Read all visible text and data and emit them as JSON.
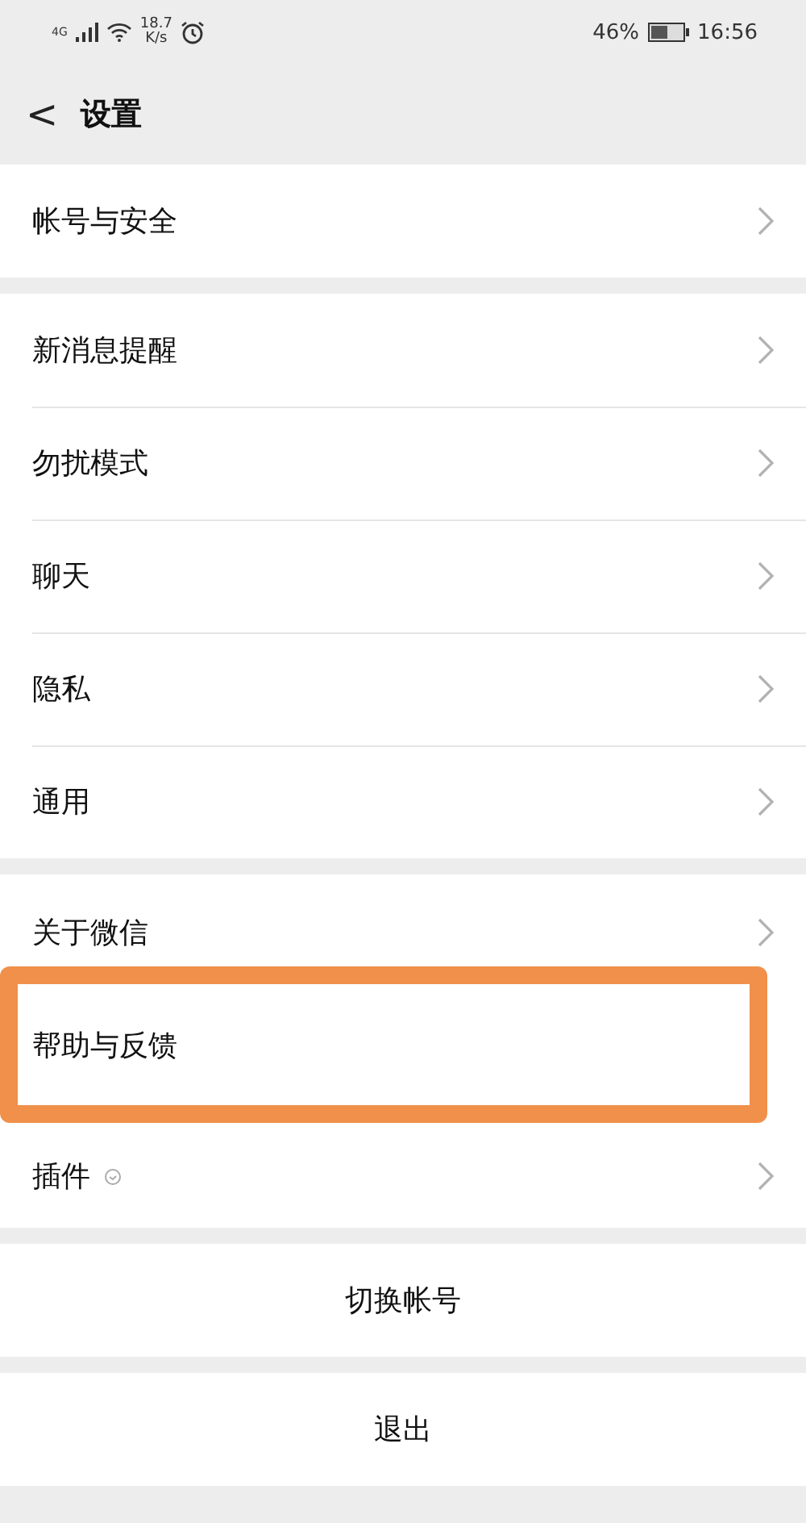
{
  "status_bar": {
    "network": "4G",
    "speed_value": "18.7",
    "speed_unit": "K/s",
    "battery": "46%",
    "time": "16:56"
  },
  "header": {
    "back": "<",
    "title": "设置"
  },
  "groups": [
    {
      "items": [
        {
          "label": "帐号与安全",
          "highlighted": false
        }
      ]
    },
    {
      "items": [
        {
          "label": "新消息提醒",
          "highlighted": false
        },
        {
          "label": "勿扰模式",
          "highlighted": false
        },
        {
          "label": "聊天",
          "highlighted": false
        },
        {
          "label": "隐私",
          "highlighted": false
        },
        {
          "label": "通用",
          "highlighted": false
        }
      ]
    },
    {
      "items": [
        {
          "label": "关于微信",
          "highlighted": false
        },
        {
          "label": "帮助与反馈",
          "highlighted": true
        },
        {
          "label": "插件",
          "highlighted": false,
          "badge_icon": true
        }
      ]
    }
  ],
  "actions": [
    "切换帐号",
    "退出"
  ]
}
